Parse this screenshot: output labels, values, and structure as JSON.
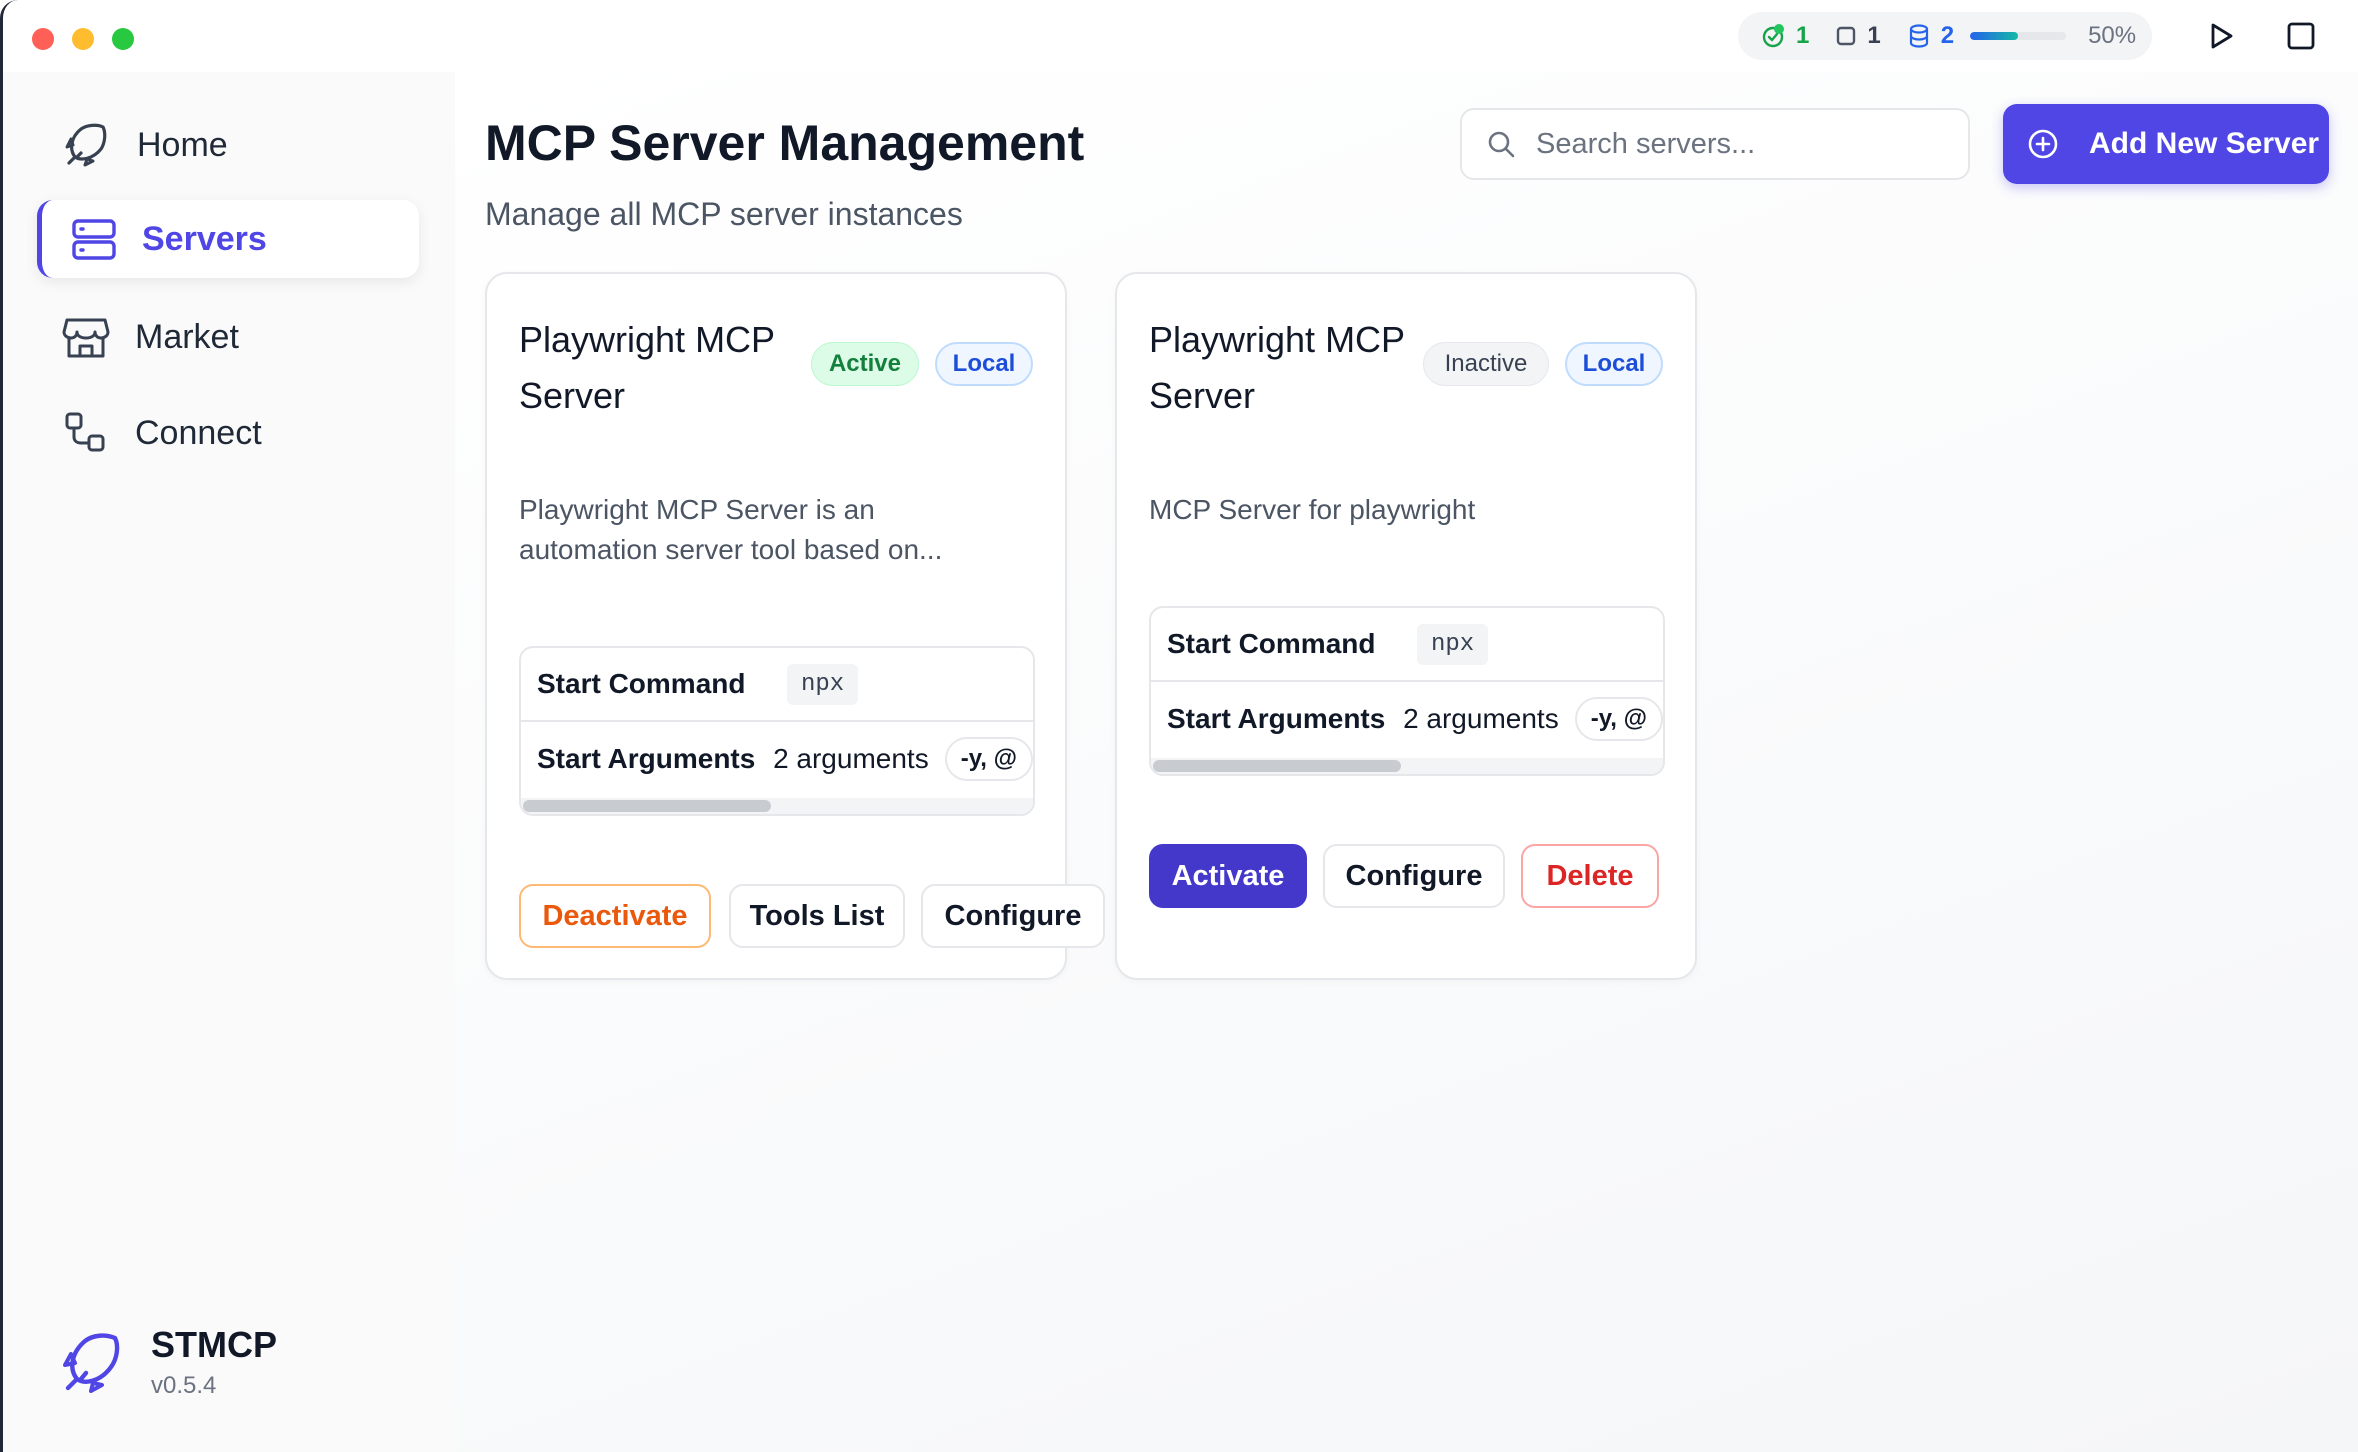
{
  "status": {
    "running_count": "1",
    "stopped_count": "1",
    "storage_count": "2",
    "usage_percent": "50%",
    "usage_fraction": 0.5
  },
  "sidebar": {
    "items": [
      {
        "label": "Home",
        "icon": "rocket-icon"
      },
      {
        "label": "Servers",
        "icon": "server-icon"
      },
      {
        "label": "Market",
        "icon": "store-icon"
      },
      {
        "label": "Connect",
        "icon": "connect-icon"
      }
    ],
    "active": "Servers",
    "brand_name": "STMCP",
    "brand_version": "v0.5.4"
  },
  "main": {
    "title": "MCP Server Management",
    "subtitle": "Manage all MCP server instances",
    "search_placeholder": "Search servers...",
    "add_button": "Add New Server"
  },
  "cards": [
    {
      "title": "Playwright MCP Server",
      "status": "Active",
      "type": "Local",
      "description": "Playwright MCP Server is an automation server tool based on...",
      "start_command_label": "Start Command",
      "start_command": "npx",
      "start_args_label": "Start Arguments",
      "start_args_count": "2 arguments",
      "start_args_preview": "-y, @",
      "actions": [
        "Deactivate",
        "Tools List",
        "Configure"
      ]
    },
    {
      "title": "Playwright MCP Server",
      "status": "Inactive",
      "type": "Local",
      "description": "MCP Server for playwright",
      "start_command_label": "Start Command",
      "start_command": "npx",
      "start_args_label": "Start Arguments",
      "start_args_count": "2 arguments",
      "start_args_preview": "-y, @",
      "actions": [
        "Activate",
        "Configure",
        "Delete"
      ]
    }
  ],
  "colors": {
    "accent": "#4f46e5",
    "active_green": "#15803d",
    "danger": "#dc2626",
    "warning": "#ea580c"
  }
}
